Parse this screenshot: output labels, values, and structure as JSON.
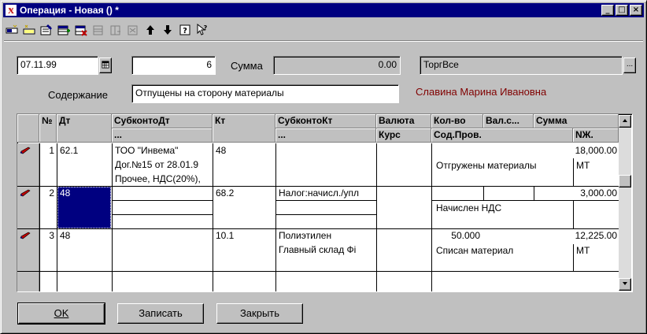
{
  "window": {
    "title": "Операция - Новая () *",
    "controls": [
      "_",
      "□",
      "×"
    ]
  },
  "toolbar": {
    "icons": [
      "new-line-icon",
      "copy-line-icon",
      "edit-line-icon",
      "add-row-icon",
      "delete-row-icon",
      "disabled-icon-1",
      "disabled-icon-2",
      "disabled-icon-3",
      "arrow-up-icon",
      "arrow-down-icon",
      "help-icon",
      "context-help-icon"
    ]
  },
  "form": {
    "date": "07.11.99",
    "date_btn": "▦",
    "number": "6",
    "sum_label": "Сумма",
    "sum": "0.00",
    "firm": "ТоргВсе",
    "firm_btn": "...",
    "content_label": "Содержание",
    "content": "Отпущены на сторону материалы",
    "author": "Славина Марина Ивановна"
  },
  "grid": {
    "headers_top": {
      "num": "№",
      "dt": "Дт",
      "subdt": "СубконтоДт",
      "kt": "Кт",
      "subkt": "СубконтоКт",
      "currency": "Валюта",
      "qty": "Кол-во",
      "valsum": "Вал.с...",
      "sum": "Сумма"
    },
    "headers_bottom": {
      "subdt": "...",
      "subkt": "...",
      "rate": "Курс",
      "content": "Сод.Пров.",
      "nzh": "NЖ."
    },
    "rows": [
      {
        "num": "1",
        "dt": "62.1",
        "subdt": [
          "ТОО \"Инвема\"",
          "Дог.№15 от 28.01.9",
          "Прочее, НДС(20%),"
        ],
        "kt": "48",
        "subkt": [],
        "qty": "",
        "sum": "18,000.00",
        "content": "Отгружены материалы",
        "nzh": "МТ"
      },
      {
        "num": "2",
        "dt": "48",
        "subdt": [],
        "kt": "68.2",
        "subkt": [
          "Налог:начисл./упл"
        ],
        "qty": "",
        "sum": "3,000.00",
        "content": "Начислен НДС",
        "nzh": ""
      },
      {
        "num": "3",
        "dt": "48",
        "subdt": [],
        "kt": "10.1",
        "subkt": [
          "Полиэтилен",
          "Главный склад Фі"
        ],
        "qty": "50.000",
        "sum": "12,225.00",
        "content": "Списан материал",
        "nzh": "МТ"
      }
    ]
  },
  "buttons": {
    "ok": "OK",
    "save": "Записать",
    "close": "Закрыть"
  },
  "colors": {
    "titlebar": "#000080",
    "face": "#c0c0c0",
    "author": "#800000",
    "selection": "#000080"
  }
}
